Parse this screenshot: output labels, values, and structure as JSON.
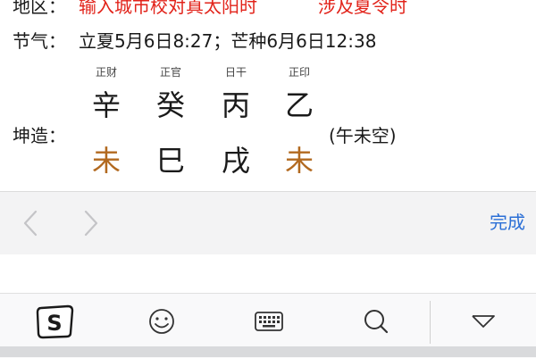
{
  "header": {
    "region_label": "地区：",
    "region_hint": "输入城市校对真太阳时",
    "dst_hint": "涉及夏令时"
  },
  "jieqi": {
    "label": "节气：",
    "value": "立夏5月6日8:27；芒种6月6日12:38"
  },
  "chart": {
    "gender_label": "坤造：",
    "kongwang": "(午未空)",
    "pillars": [
      {
        "shishen": "正财",
        "stem": "辛",
        "branch": "未",
        "branch_color": "#b2691f"
      },
      {
        "shishen": "正官",
        "stem": "癸",
        "branch": "巳",
        "branch_color": "#1a1a1a"
      },
      {
        "shishen": "日干",
        "stem": "丙",
        "branch": "戌",
        "branch_color": "#1a1a1a"
      },
      {
        "shishen": "正印",
        "stem": "乙",
        "branch": "未",
        "branch_color": "#b2691f"
      }
    ]
  },
  "accessory_bar": {
    "prev_icon": "chevron-left-icon",
    "next_icon": "chevron-right-icon",
    "done_label": "完成",
    "done_color": "#2b6fd6"
  },
  "keyboard_toolbar": {
    "items": [
      "sogou-logo-icon",
      "emoji-icon",
      "keyboard-icon",
      "search-icon",
      "collapse-keyboard-icon"
    ]
  },
  "colors": {
    "highlight_red": "#e2231a",
    "accent_brown": "#b2691f"
  }
}
